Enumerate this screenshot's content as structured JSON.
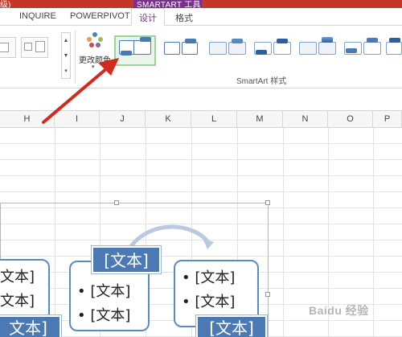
{
  "titlebar": {
    "left_text": "级)"
  },
  "context_tab": {
    "label": "SMARTART 工具"
  },
  "tabs": [
    {
      "label": "INQUIRE"
    },
    {
      "label": "POWERPIVOT"
    },
    {
      "label": "设计"
    },
    {
      "label": "格式"
    }
  ],
  "ribbon": {
    "change_colors_label": "更改颜色",
    "styles_group_label": "SmartArt 样式",
    "scroll_up": "▲",
    "scroll_down": "▼",
    "scroll_more": "▾",
    "dropdown_arrow": "▾"
  },
  "columns": [
    "H",
    "I",
    "J",
    "K",
    "L",
    "M",
    "N",
    "O",
    "P"
  ],
  "smartart": {
    "left_box": {
      "lines": [
        "文本]",
        "文本]"
      ],
      "title": "文本]"
    },
    "middle_box": {
      "title": "[文本]",
      "bullets": [
        "[文本]",
        "[文本]"
      ]
    },
    "right_box": {
      "title": "[文本]",
      "bullets": [
        "[文本]",
        "[文本]"
      ]
    }
  },
  "watermark": {
    "text": "Baidu 经验"
  },
  "colors": {
    "accent_purple": "#7b2f8e",
    "title_red": "#c53627",
    "shape_blue": "#4a79b4",
    "arrow_red": "#d42a1e"
  }
}
